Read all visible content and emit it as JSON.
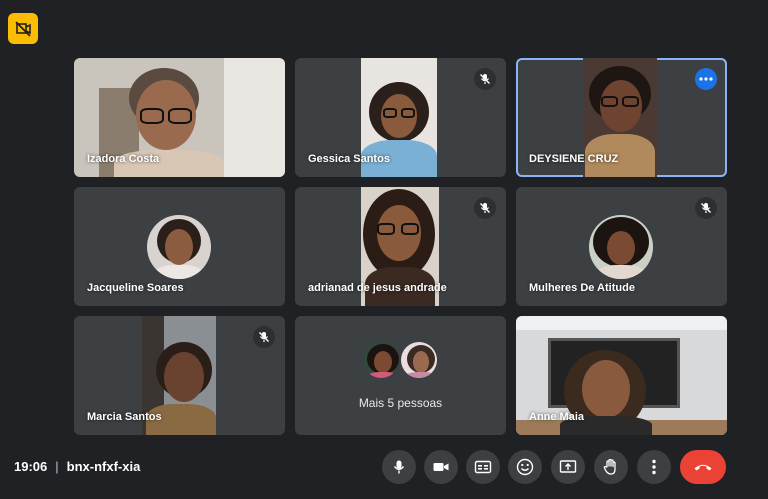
{
  "participants": [
    {
      "name": "Izadora Costa"
    },
    {
      "name": "Gessica Santos"
    },
    {
      "name": "DEYSIENE CRUZ"
    },
    {
      "name": "Jacqueline Soares"
    },
    {
      "name": "adrianad de jesus andrade"
    },
    {
      "name": "Mulheres De Atitude"
    },
    {
      "name": "Marcia Santos"
    },
    {
      "name": "Mais 5 pessoas"
    },
    {
      "name": "Anne Maia"
    }
  ],
  "meeting": {
    "time": "19:06",
    "separator": "|",
    "code": "bnx-nfxf-xia"
  },
  "controls": [
    "mic-icon",
    "camera-icon",
    "captions-icon",
    "emoji-icon",
    "present-icon",
    "raise-hand-icon",
    "more-options-icon",
    "end-call-icon"
  ],
  "colors": {
    "background": "#202124",
    "tile": "#3c4043",
    "active_border": "#8ab4f8",
    "end_call": "#ea4335",
    "badge": "#fbbc04",
    "more_dots": "#1a73e8"
  }
}
